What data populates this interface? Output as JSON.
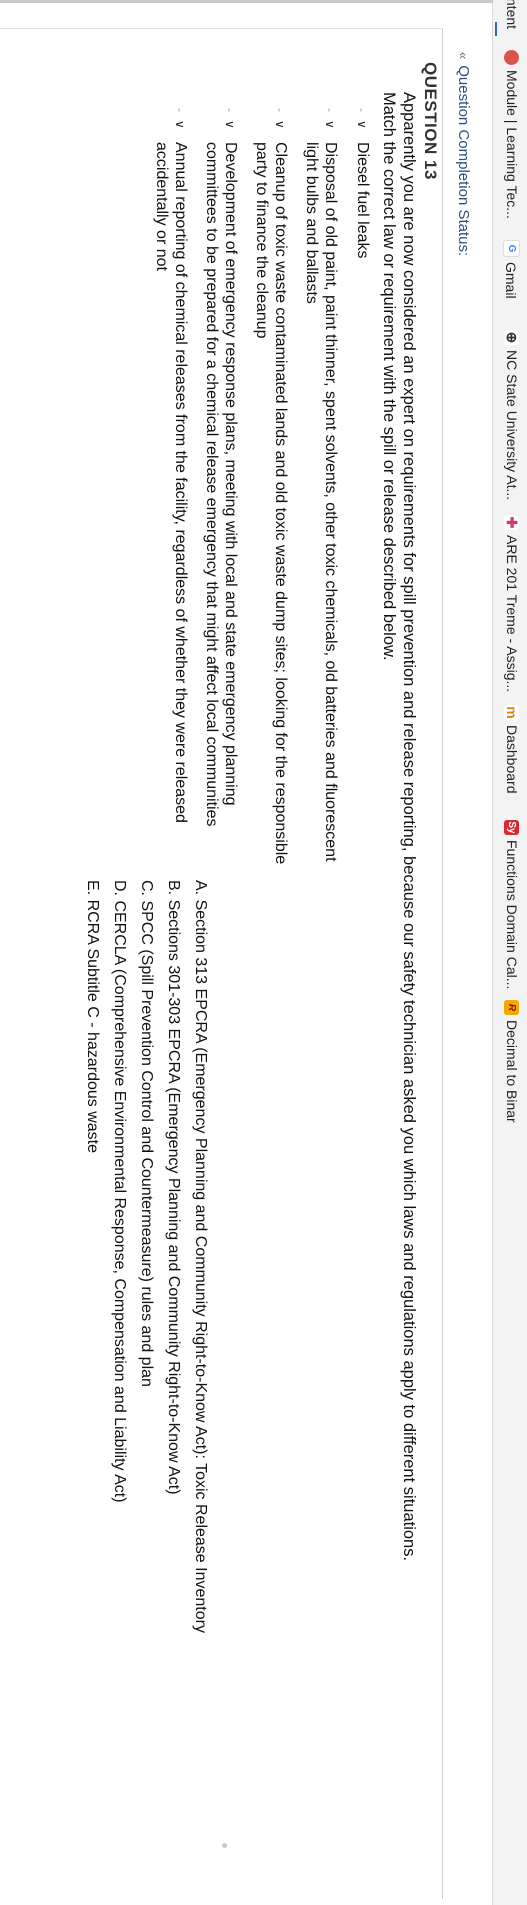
{
  "bookmarks": [
    {
      "label": "Content",
      "icon": "content-icon"
    },
    {
      "label": "Module | Learning Tec...",
      "icon": "module-icon"
    },
    {
      "label": "Gmail",
      "icon": "gmail-icon"
    },
    {
      "label": "NC State University At...",
      "icon": "globe-icon"
    },
    {
      "label": "ARE 201 Treme - Assig...",
      "icon": "plus-icon"
    },
    {
      "label": "Dashboard",
      "icon": "mh-icon"
    },
    {
      "label": "Functions Domain Cal...",
      "icon": "sy-icon"
    },
    {
      "label": "Decimal to Binar",
      "icon": "r-icon"
    }
  ],
  "bookmark_icon_glyphs": {
    "content": "",
    "module": "",
    "gmail": "G",
    "globe": "⊕",
    "plus": "✚",
    "mh": "m",
    "sy": "Sy",
    "r": "R"
  },
  "status": {
    "label": "Question Completion Status:",
    "chevron": "«"
  },
  "question": {
    "heading": "QUESTION 13",
    "intro_1": "Apparently you are now considered an expert on requirements for spill prevention and release reporting, because our safety technician asked you which laws and regulations apply to different situations.",
    "intro_2": "Match the correct law or requirement with the spill or release described below."
  },
  "match_items": [
    {
      "dash": "-",
      "caret": "∨",
      "text": "Diesel fuel leaks"
    },
    {
      "dash": "-",
      "caret": "∨",
      "text": "Disposal of old paint, paint thinner, spent solvents, other toxic chemicals, old batteries and fluorescent light bulbs and ballasts"
    },
    {
      "dash": "-",
      "caret": "∨",
      "text": "Cleanup of toxic waste contaminated lands and old toxic waste dump sites; looking for the responsible party to finance the cleanup"
    },
    {
      "dash": "-",
      "caret": "∨",
      "text": "Development of emergency response plans, meeting with local and state emergency planning committees to be prepared for a chemical release emergency that might affect local communities"
    },
    {
      "dash": "-",
      "caret": "∨",
      "text": "Annual reporting of chemical releases from the facility, regardless of whether they were released accidentally or not"
    }
  ],
  "answers": [
    {
      "text": "A. Section 313 EPCRA (Emergency Planning and Community Right-to-Know Act): Toxic Release Inventory"
    },
    {
      "text": "B. Sections 301-303 EPCRA (Emergency Planning and Community Right-to-Know Act)"
    },
    {
      "text": "C. SPCC (Spill Prevention Control and Countermeasure) rules and plan"
    },
    {
      "text": "D. CERCLA (Comprehensive Environmental Response, Compensation and Liability Act)"
    },
    {
      "text": "E. RCRA Subtitle C - hazardous waste"
    }
  ]
}
